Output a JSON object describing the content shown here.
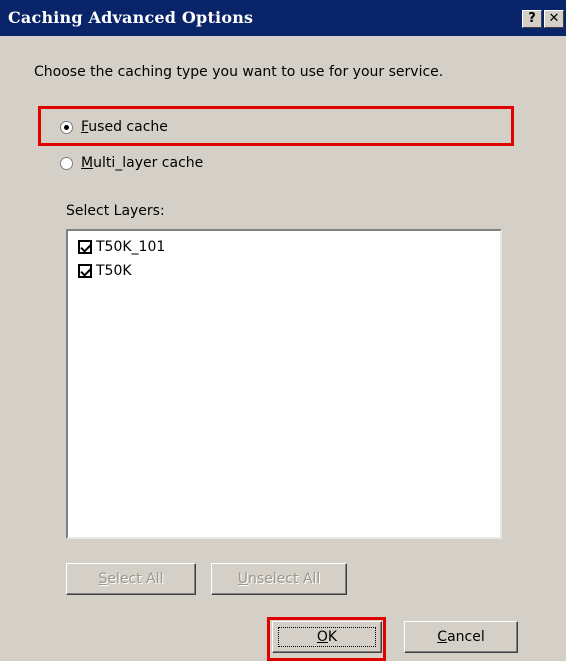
{
  "window": {
    "title": "Caching Advanced Options",
    "help_glyph": "?",
    "close_glyph": "✕"
  },
  "instruction": "Choose the caching type you want to use for your service.",
  "caching_type": {
    "selected": "fused",
    "options": [
      {
        "id": "fused",
        "mnemonic": "F",
        "rest": "used cache",
        "checked": true
      },
      {
        "id": "multi_layer",
        "mnemonic": "M",
        "rest": "ulti_layer cache",
        "checked": false
      }
    ]
  },
  "layers": {
    "label": "Select Layers:",
    "items": [
      {
        "name": "T50K_101",
        "checked": true
      },
      {
        "name": "T50K",
        "checked": true
      }
    ]
  },
  "buttons": {
    "select_all": {
      "mnemonic": "S",
      "rest": "elect All",
      "enabled": false
    },
    "unselect_all": {
      "mnemonic": "U",
      "rest": "nselect All",
      "enabled": false
    },
    "ok": {
      "mnemonic": "O",
      "rest": "K"
    },
    "cancel": {
      "mnemonic": "C",
      "rest": "ancel"
    }
  },
  "annotation_color": "#e00000"
}
